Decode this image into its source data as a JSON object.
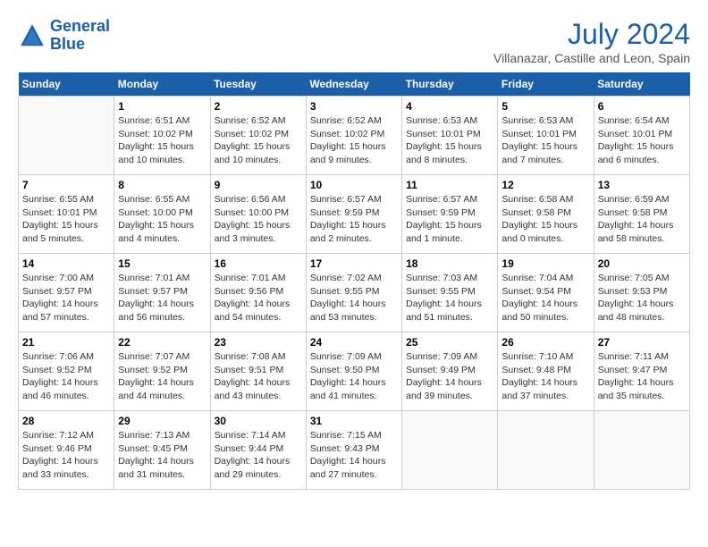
{
  "header": {
    "logo_line1": "General",
    "logo_line2": "Blue",
    "month_year": "July 2024",
    "location": "Villanazar, Castille and Leon, Spain"
  },
  "weekdays": [
    "Sunday",
    "Monday",
    "Tuesday",
    "Wednesday",
    "Thursday",
    "Friday",
    "Saturday"
  ],
  "weeks": [
    [
      {
        "day": "",
        "info": ""
      },
      {
        "day": "1",
        "info": "Sunrise: 6:51 AM\nSunset: 10:02 PM\nDaylight: 15 hours\nand 10 minutes."
      },
      {
        "day": "2",
        "info": "Sunrise: 6:52 AM\nSunset: 10:02 PM\nDaylight: 15 hours\nand 10 minutes."
      },
      {
        "day": "3",
        "info": "Sunrise: 6:52 AM\nSunset: 10:02 PM\nDaylight: 15 hours\nand 9 minutes."
      },
      {
        "day": "4",
        "info": "Sunrise: 6:53 AM\nSunset: 10:01 PM\nDaylight: 15 hours\nand 8 minutes."
      },
      {
        "day": "5",
        "info": "Sunrise: 6:53 AM\nSunset: 10:01 PM\nDaylight: 15 hours\nand 7 minutes."
      },
      {
        "day": "6",
        "info": "Sunrise: 6:54 AM\nSunset: 10:01 PM\nDaylight: 15 hours\nand 6 minutes."
      }
    ],
    [
      {
        "day": "7",
        "info": "Sunrise: 6:55 AM\nSunset: 10:01 PM\nDaylight: 15 hours\nand 5 minutes."
      },
      {
        "day": "8",
        "info": "Sunrise: 6:55 AM\nSunset: 10:00 PM\nDaylight: 15 hours\nand 4 minutes."
      },
      {
        "day": "9",
        "info": "Sunrise: 6:56 AM\nSunset: 10:00 PM\nDaylight: 15 hours\nand 3 minutes."
      },
      {
        "day": "10",
        "info": "Sunrise: 6:57 AM\nSunset: 9:59 PM\nDaylight: 15 hours\nand 2 minutes."
      },
      {
        "day": "11",
        "info": "Sunrise: 6:57 AM\nSunset: 9:59 PM\nDaylight: 15 hours\nand 1 minute."
      },
      {
        "day": "12",
        "info": "Sunrise: 6:58 AM\nSunset: 9:58 PM\nDaylight: 15 hours\nand 0 minutes."
      },
      {
        "day": "13",
        "info": "Sunrise: 6:59 AM\nSunset: 9:58 PM\nDaylight: 14 hours\nand 58 minutes."
      }
    ],
    [
      {
        "day": "14",
        "info": "Sunrise: 7:00 AM\nSunset: 9:57 PM\nDaylight: 14 hours\nand 57 minutes."
      },
      {
        "day": "15",
        "info": "Sunrise: 7:01 AM\nSunset: 9:57 PM\nDaylight: 14 hours\nand 56 minutes."
      },
      {
        "day": "16",
        "info": "Sunrise: 7:01 AM\nSunset: 9:56 PM\nDaylight: 14 hours\nand 54 minutes."
      },
      {
        "day": "17",
        "info": "Sunrise: 7:02 AM\nSunset: 9:55 PM\nDaylight: 14 hours\nand 53 minutes."
      },
      {
        "day": "18",
        "info": "Sunrise: 7:03 AM\nSunset: 9:55 PM\nDaylight: 14 hours\nand 51 minutes."
      },
      {
        "day": "19",
        "info": "Sunrise: 7:04 AM\nSunset: 9:54 PM\nDaylight: 14 hours\nand 50 minutes."
      },
      {
        "day": "20",
        "info": "Sunrise: 7:05 AM\nSunset: 9:53 PM\nDaylight: 14 hours\nand 48 minutes."
      }
    ],
    [
      {
        "day": "21",
        "info": "Sunrise: 7:06 AM\nSunset: 9:52 PM\nDaylight: 14 hours\nand 46 minutes."
      },
      {
        "day": "22",
        "info": "Sunrise: 7:07 AM\nSunset: 9:52 PM\nDaylight: 14 hours\nand 44 minutes."
      },
      {
        "day": "23",
        "info": "Sunrise: 7:08 AM\nSunset: 9:51 PM\nDaylight: 14 hours\nand 43 minutes."
      },
      {
        "day": "24",
        "info": "Sunrise: 7:09 AM\nSunset: 9:50 PM\nDaylight: 14 hours\nand 41 minutes."
      },
      {
        "day": "25",
        "info": "Sunrise: 7:09 AM\nSunset: 9:49 PM\nDaylight: 14 hours\nand 39 minutes."
      },
      {
        "day": "26",
        "info": "Sunrise: 7:10 AM\nSunset: 9:48 PM\nDaylight: 14 hours\nand 37 minutes."
      },
      {
        "day": "27",
        "info": "Sunrise: 7:11 AM\nSunset: 9:47 PM\nDaylight: 14 hours\nand 35 minutes."
      }
    ],
    [
      {
        "day": "28",
        "info": "Sunrise: 7:12 AM\nSunset: 9:46 PM\nDaylight: 14 hours\nand 33 minutes."
      },
      {
        "day": "29",
        "info": "Sunrise: 7:13 AM\nSunset: 9:45 PM\nDaylight: 14 hours\nand 31 minutes."
      },
      {
        "day": "30",
        "info": "Sunrise: 7:14 AM\nSunset: 9:44 PM\nDaylight: 14 hours\nand 29 minutes."
      },
      {
        "day": "31",
        "info": "Sunrise: 7:15 AM\nSunset: 9:43 PM\nDaylight: 14 hours\nand 27 minutes."
      },
      {
        "day": "",
        "info": ""
      },
      {
        "day": "",
        "info": ""
      },
      {
        "day": "",
        "info": ""
      }
    ]
  ]
}
